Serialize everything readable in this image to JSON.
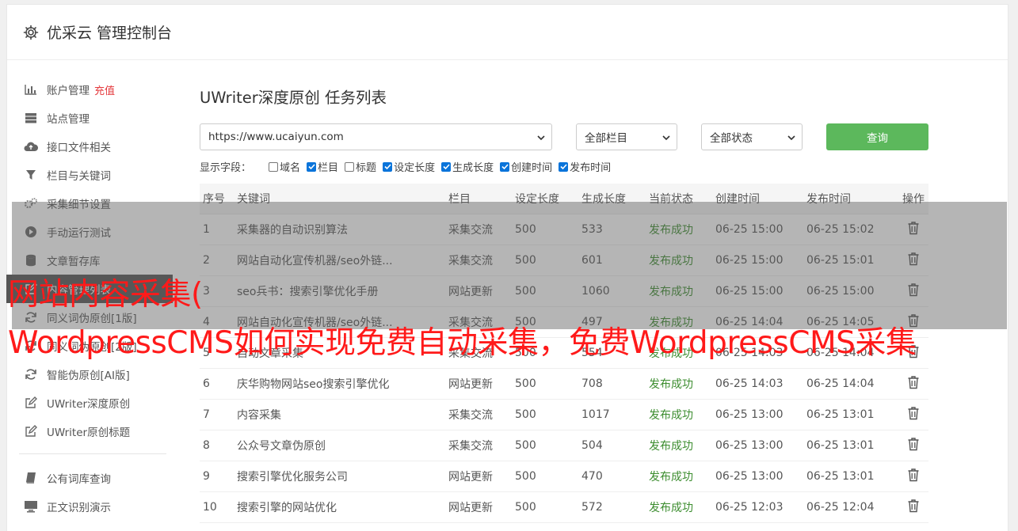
{
  "header": {
    "title": "优采云 管理控制台",
    "icon": "gear-icon"
  },
  "sidebar": {
    "group1": [
      {
        "label": "账户管理",
        "extra": "充值",
        "icon": "bar-chart-icon"
      },
      {
        "label": "站点管理",
        "icon": "server-icon"
      },
      {
        "label": "接口文件相关",
        "icon": "cloud-upload-icon"
      },
      {
        "label": "栏目与关键词",
        "icon": "filter-icon"
      },
      {
        "label": "采集细节设置",
        "icon": "gears-icon"
      },
      {
        "label": "手动运行测试",
        "icon": "play-icon"
      },
      {
        "label": "文章暂存库",
        "icon": "database-icon"
      },
      {
        "label": "内容管理列表",
        "icon": "edit-icon",
        "active": true
      },
      {
        "label": "同义词伪原创[1版]",
        "icon": "refresh-icon"
      },
      {
        "label": "同义词伪原创[2版]",
        "icon": "refresh-icon"
      },
      {
        "label": "智能伪原创[AI版]",
        "icon": "refresh-icon"
      },
      {
        "label": "UWriter深度原创",
        "icon": "edit-icon"
      },
      {
        "label": "UWriter原创标题",
        "icon": "edit-icon"
      }
    ],
    "group2": [
      {
        "label": "公有词库查询",
        "icon": "book-icon"
      },
      {
        "label": "正文识别演示",
        "icon": "monitor-icon"
      }
    ]
  },
  "main": {
    "title": "UWriter深度原创 任务列表",
    "site_select": "https://www.ucaiyun.com",
    "column_select": "全部栏目",
    "status_select": "全部状态",
    "query_button": "查询",
    "fields_label": "显示字段：",
    "fields": [
      {
        "label": "域名",
        "checked": false
      },
      {
        "label": "栏目",
        "checked": true
      },
      {
        "label": "标题",
        "checked": false
      },
      {
        "label": "设定长度",
        "checked": true
      },
      {
        "label": "生成长度",
        "checked": true
      },
      {
        "label": "创建时间",
        "checked": true
      },
      {
        "label": "发布时间",
        "checked": true
      }
    ]
  },
  "table": {
    "headers": [
      "序号",
      "关键词",
      "栏目",
      "设定长度",
      "生成长度",
      "当前状态",
      "创建时间",
      "发布时间",
      "操作"
    ],
    "rows": [
      [
        "1",
        "采集器的自动识别算法",
        "采集交流",
        "500",
        "533",
        "发布成功",
        "06-25 15:00",
        "06-25 15:02"
      ],
      [
        "2",
        "网站自动化宣传机器/seo外链...",
        "采集交流",
        "500",
        "601",
        "发布成功",
        "06-25 15:00",
        "06-25 15:01"
      ],
      [
        "3",
        "seo兵书：搜索引擎优化手册",
        "网站更新",
        "500",
        "1060",
        "发布成功",
        "06-25 15:00",
        "06-25 15:00"
      ],
      [
        "4",
        "网站自动化宣传机器/seo外链...",
        "采集交流",
        "500",
        "497",
        "发布成功",
        "06-25 14:04",
        "06-25 14:05"
      ],
      [
        "5",
        "自动文章采集",
        "采集交流",
        "500",
        "554",
        "发布成功",
        "06-25 14:03",
        "06-25 14:04"
      ],
      [
        "6",
        "庆华购物网站seo搜索引擎优化",
        "网站更新",
        "500",
        "708",
        "发布成功",
        "06-25 14:03",
        "06-25 14:04"
      ],
      [
        "7",
        "内容采集",
        "采集交流",
        "500",
        "1017",
        "发布成功",
        "06-25 13:00",
        "06-25 13:01"
      ],
      [
        "8",
        "公众号文章伪原创",
        "采集交流",
        "500",
        "504",
        "发布成功",
        "06-25 13:00",
        "06-25 13:01"
      ],
      [
        "9",
        "搜索引擎优化服务公司",
        "网站更新",
        "500",
        "470",
        "发布成功",
        "06-25 13:00",
        "06-25 13:01"
      ],
      [
        "10",
        "搜索引擎的网站优化",
        "网站更新",
        "500",
        "572",
        "发布成功",
        "06-25 12:03",
        "06-25 12:04"
      ]
    ]
  },
  "overlay": {
    "line1": "网站内容采集(",
    "line2": "WordpressCMS如何实现免费自动采集，免费WordpressCMS采集"
  },
  "colors": {
    "accent": "#5cb85c",
    "status": "#3c8d2f",
    "overlay_text": "#ff1a1a",
    "extra": "#e4393c"
  }
}
